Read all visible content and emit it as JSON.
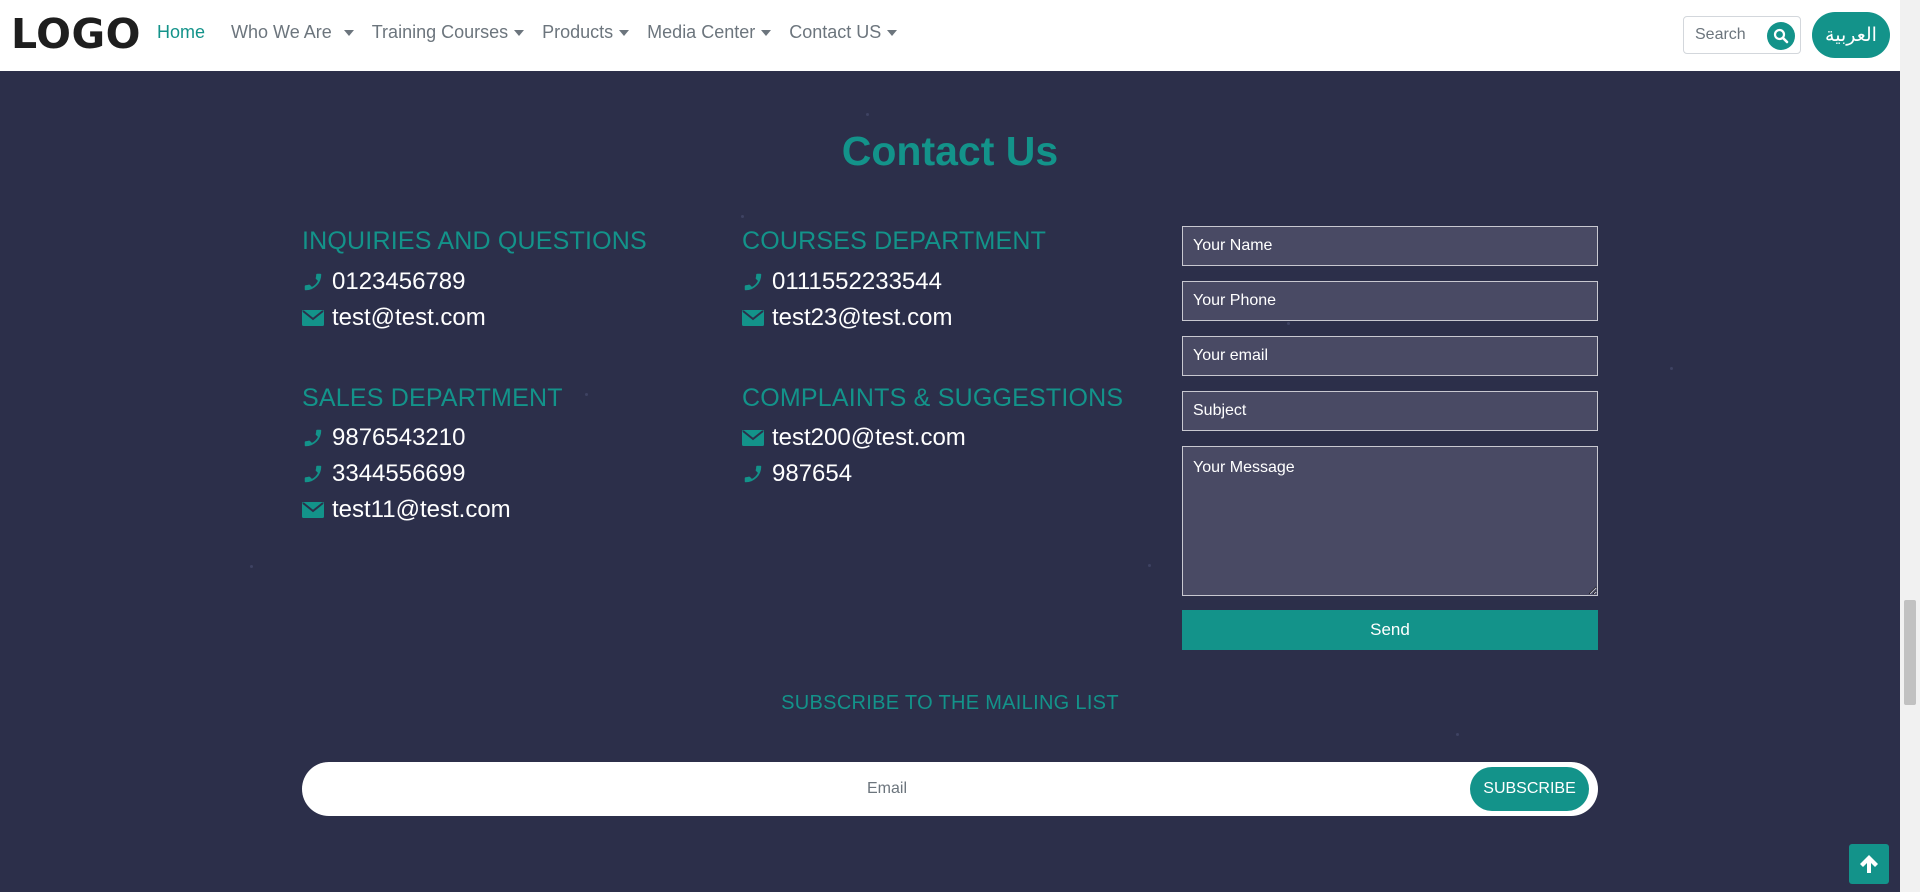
{
  "header": {
    "logo": "LOGO",
    "nav": [
      {
        "label": "Home",
        "active": true,
        "dropdown": false
      },
      {
        "label": "Who We Are",
        "active": false,
        "dropdown": true
      },
      {
        "label": "Training Courses",
        "active": false,
        "dropdown": true
      },
      {
        "label": "Products",
        "active": false,
        "dropdown": true
      },
      {
        "label": "Media Center",
        "active": false,
        "dropdown": true
      },
      {
        "label": "Contact US",
        "active": false,
        "dropdown": true
      }
    ],
    "search_placeholder": "Search",
    "lang_button": "العربية"
  },
  "contact": {
    "title": "Contact Us",
    "sections": [
      {
        "heading": "INQUIRIES AND QUESTIONS",
        "lines": [
          {
            "icon": "phone-icon",
            "text": "0123456789"
          },
          {
            "icon": "envelope-icon",
            "text": "test@test.com"
          }
        ]
      },
      {
        "heading": "COURSES DEPARTMENT",
        "lines": [
          {
            "icon": "phone-icon",
            "text": "0111552233544"
          },
          {
            "icon": "envelope-icon",
            "text": "test23@test.com"
          }
        ]
      },
      {
        "heading": "SALES DEPARTMENT",
        "lines": [
          {
            "icon": "phone-icon",
            "text": "9876543210"
          },
          {
            "icon": "phone-icon",
            "text": "3344556699"
          },
          {
            "icon": "envelope-icon",
            "text": "test11@test.com"
          }
        ]
      },
      {
        "heading": "COMPLAINTS & SUGGESTIONS",
        "lines": [
          {
            "icon": "envelope-icon",
            "text": "test200@test.com"
          },
          {
            "icon": "phone-icon",
            "text": "987654"
          }
        ]
      }
    ],
    "form": {
      "name_placeholder": "Your Name",
      "phone_placeholder": "Your Phone",
      "email_placeholder": "Your email",
      "subject_placeholder": "Subject",
      "message_placeholder": "Your Message",
      "send_label": "Send"
    }
  },
  "subscribe": {
    "title": "SUBSCRIBE TO THE MAILING LIST",
    "email_placeholder": "Email",
    "button_label": "SUBSCRIBE"
  },
  "colors": {
    "accent": "#13938a",
    "background": "#2c2f4a",
    "field": "#494a64"
  }
}
